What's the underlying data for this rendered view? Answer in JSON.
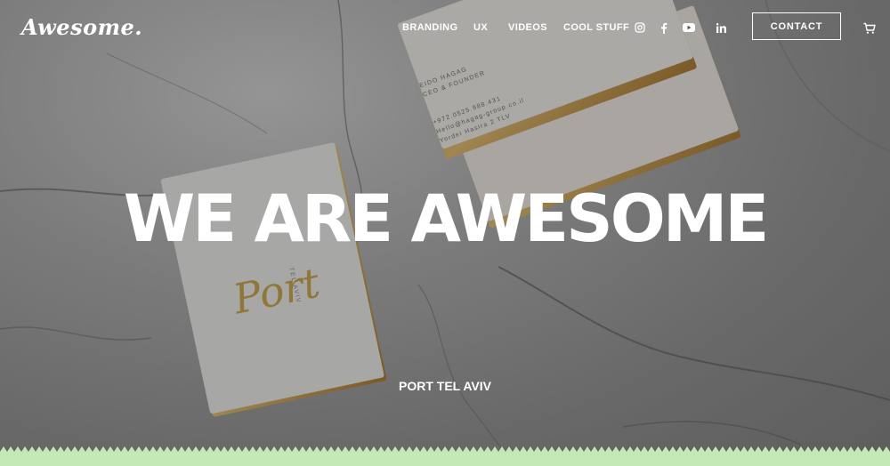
{
  "brand": {
    "logo_text": "Awesome."
  },
  "nav": {
    "items": [
      {
        "label": "BRANDING"
      },
      {
        "label": "UX"
      },
      {
        "label": "VIDEOS"
      },
      {
        "label": "COOL STUFF"
      }
    ],
    "social": [
      "instagram-icon",
      "facebook-icon",
      "youtube-icon",
      "linkedin-icon"
    ],
    "contact_label": "CONTACT",
    "cart_icon": "cart-icon"
  },
  "hero": {
    "headline": "WE ARE AWESOME",
    "subtitle": "PORT TEL AVIV",
    "card_back": {
      "name": "EIDO HAGAG",
      "role": "CEO & FOUNDER",
      "phone": "+972.0525.988.431",
      "email": "Hello@hagag-group.co.il",
      "address": "Yordei Hasira 2 TLV"
    },
    "card_front": {
      "script": "Port",
      "city": "TEL AVIV"
    }
  },
  "colors": {
    "strip_green": "#c5e8b7",
    "overlay": "#333333"
  }
}
